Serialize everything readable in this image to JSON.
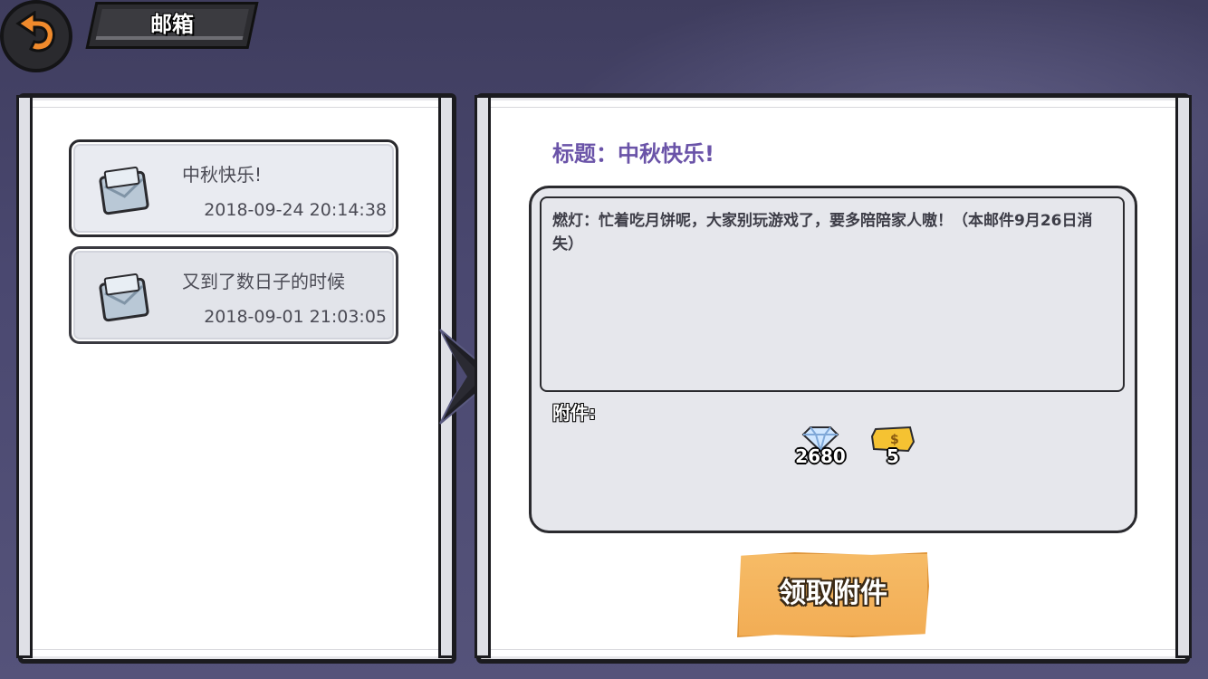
{
  "header": {
    "title": "邮箱",
    "back_icon": "back-arrow-icon"
  },
  "mail_list": [
    {
      "title": "中秋快乐!",
      "date": "2018-09-24 20:14:38",
      "icon": "envelope-icon"
    },
    {
      "title": "又到了数日子的时候",
      "date": "2018-09-01 21:03:05",
      "icon": "envelope-icon"
    }
  ],
  "detail": {
    "subject_label": "标题：中秋快乐!",
    "body": "燃灯：忙着吃月饼呢，大家别玩游戏了，要多陪陪家人嗷！（本邮件9月26日消失）",
    "attachments_label": "附件:",
    "attachments": [
      {
        "icon": "diamond-icon",
        "count": "2680"
      },
      {
        "icon": "gold-ticket-icon",
        "count": "5"
      }
    ],
    "claim_button": "领取附件"
  },
  "colors": {
    "subject": "#6a53a8",
    "button": "#f2ad55",
    "background": "#4a4870"
  }
}
